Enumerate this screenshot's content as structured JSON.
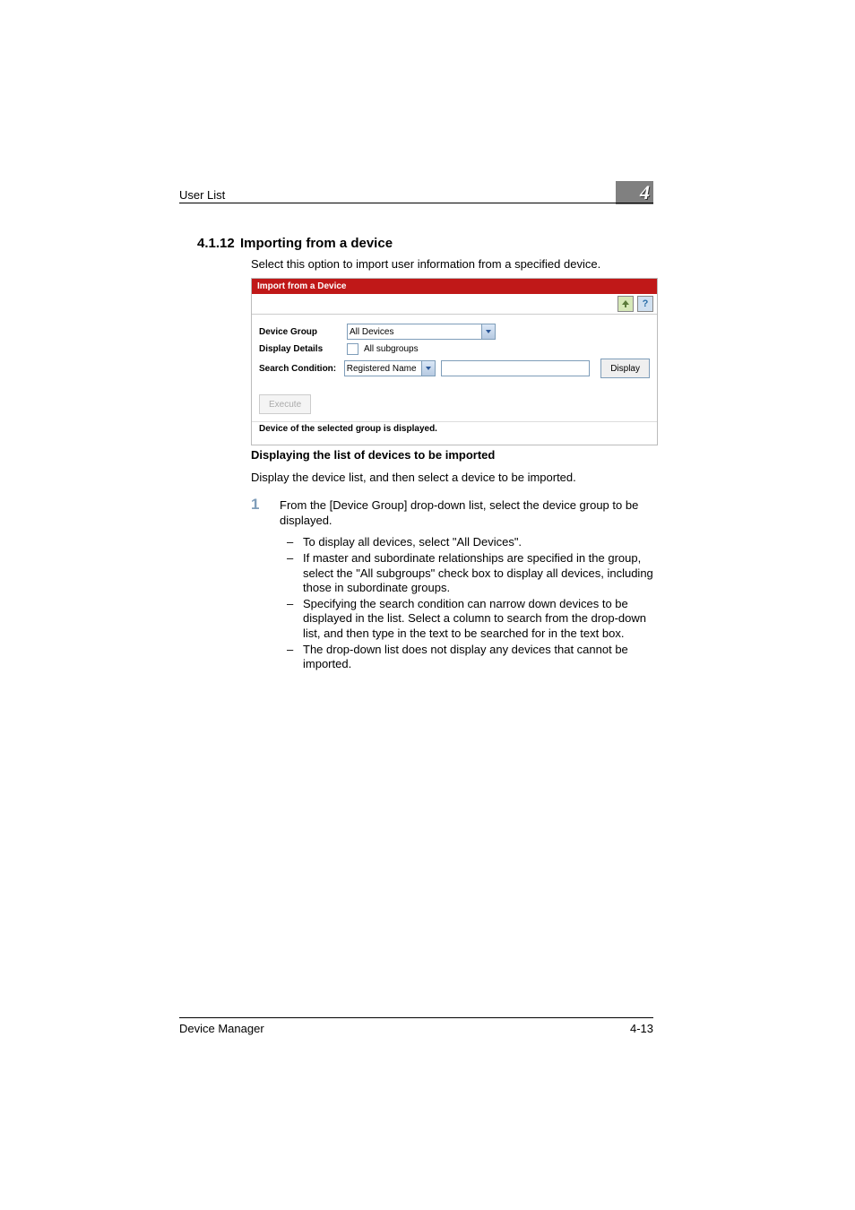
{
  "header": {
    "running_title": "User List",
    "chapter_number": "4"
  },
  "section": {
    "number": "4.1.12",
    "title": "Importing from a device",
    "description": "Select this option to import user information from a specified device."
  },
  "panel": {
    "titlebar": "Import from a Device",
    "icons": {
      "up": "up-icon",
      "help": "?"
    },
    "form": {
      "device_group_label": "Device Group",
      "device_group_value": "All Devices",
      "display_details_label": "Display Details",
      "all_subgroups_label": "All subgroups",
      "search_condition_label": "Search Condition:",
      "search_condition_value": "Registered Name",
      "search_text_value": "",
      "display_button": "Display",
      "execute_button": "Execute"
    },
    "message": "Device of the selected group is displayed."
  },
  "subsection": {
    "heading": "Displaying the list of devices to be imported",
    "description": "Display the device list, and then select a device to be imported.",
    "step_number": "1",
    "step_main": "From the [Device Group] drop-down list, select the device group to be displayed.",
    "bullets": [
      "To display all devices, select \"All Devices\".",
      "If master and subordinate relationships are specified in the group, select the \"All subgroups\" check box to display all devices, including those in subordinate groups.",
      "Specifying the search condition can narrow down devices to be displayed in the list. Select a column to search from the drop-down list, and then type in the text to be searched for in the text box.",
      "The drop-down list does not display any devices that cannot be imported."
    ]
  },
  "footer": {
    "left": "Device Manager",
    "right": "4-13"
  }
}
